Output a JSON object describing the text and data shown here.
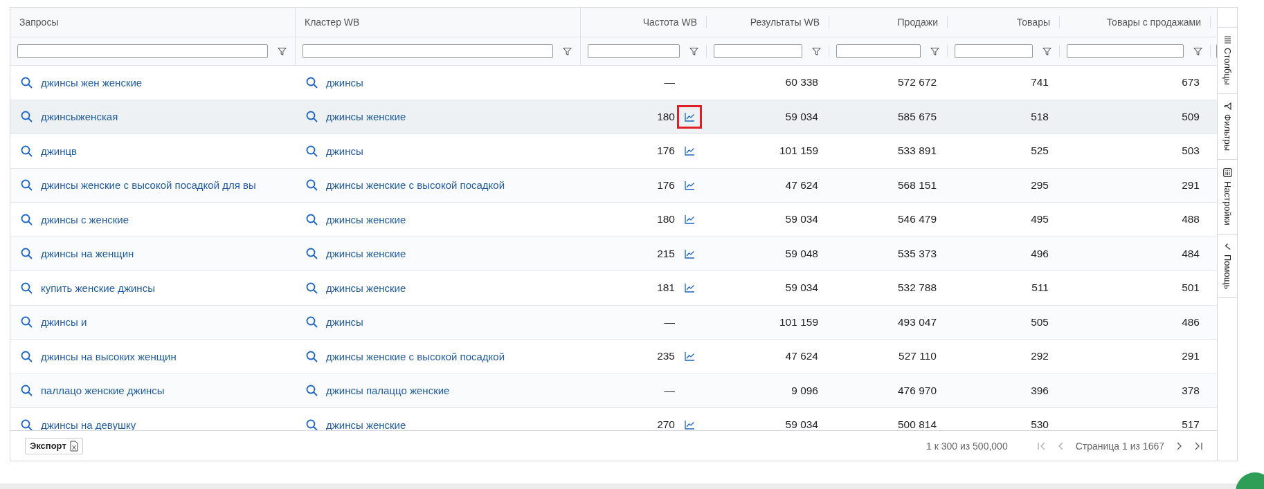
{
  "table": {
    "columns": [
      {
        "label": "Запросы"
      },
      {
        "label": "Кластер WB"
      },
      {
        "label": "Частота WB"
      },
      {
        "label": "Результаты WB"
      },
      {
        "label": "Продажи"
      },
      {
        "label": "Товары"
      },
      {
        "label": "Товары с продажами"
      }
    ],
    "rows": [
      {
        "query": "джинсы жен женские",
        "cluster": "джинсы",
        "frequency": "—",
        "chart": false,
        "results": "60 338",
        "sales": "572 672",
        "products": "741",
        "products_with_sales": "673",
        "selected": false
      },
      {
        "query": "джинсыженская",
        "cluster": "джинсы женские",
        "frequency": "180",
        "chart": true,
        "chart_highlighted": true,
        "results": "59 034",
        "sales": "585 675",
        "products": "518",
        "products_with_sales": "509",
        "selected": true
      },
      {
        "query": "джинцв",
        "cluster": "джинсы",
        "frequency": "176",
        "chart": true,
        "chart_highlighted": false,
        "results": "101 159",
        "sales": "533 891",
        "products": "525",
        "products_with_sales": "503",
        "selected": false
      },
      {
        "query": "джинсы женские с высокой посадкой для вы",
        "cluster": "джинсы женские с высокой посадкой",
        "frequency": "176",
        "chart": true,
        "chart_highlighted": false,
        "results": "47 624",
        "sales": "568 151",
        "products": "295",
        "products_with_sales": "291",
        "selected": false
      },
      {
        "query": "джинсы с женские",
        "cluster": "джинсы женские",
        "frequency": "180",
        "chart": true,
        "chart_highlighted": false,
        "results": "59 034",
        "sales": "546 479",
        "products": "495",
        "products_with_sales": "488",
        "selected": false
      },
      {
        "query": "джинсы на женщин",
        "cluster": "джинсы женские",
        "frequency": "215",
        "chart": true,
        "chart_highlighted": false,
        "results": "59 048",
        "sales": "535 373",
        "products": "496",
        "products_with_sales": "484",
        "selected": false
      },
      {
        "query": "купить женские джинсы",
        "cluster": "джинсы женские",
        "frequency": "181",
        "chart": true,
        "chart_highlighted": false,
        "results": "59 034",
        "sales": "532 788",
        "products": "511",
        "products_with_sales": "501",
        "selected": false
      },
      {
        "query": "джинсы и",
        "cluster": "джинсы",
        "frequency": "—",
        "chart": false,
        "results": "101 159",
        "sales": "493 047",
        "products": "505",
        "products_with_sales": "486",
        "selected": false
      },
      {
        "query": "джинсы на высоких женщин",
        "cluster": "джинсы женские с высокой посадкой",
        "frequency": "235",
        "chart": true,
        "chart_highlighted": false,
        "results": "47 624",
        "sales": "527 110",
        "products": "292",
        "products_with_sales": "291",
        "selected": false
      },
      {
        "query": "паллацо женские джинсы",
        "cluster": "джинсы палаццо женские",
        "frequency": "—",
        "chart": false,
        "results": "9 096",
        "sales": "476 970",
        "products": "396",
        "products_with_sales": "378",
        "selected": false
      },
      {
        "query": "джинсы на девушку",
        "cluster": "джинсы женские",
        "frequency": "270",
        "chart": true,
        "chart_highlighted": false,
        "results": "59 034",
        "sales": "500 814",
        "products": "530",
        "products_with_sales": "517",
        "selected": false
      }
    ]
  },
  "side_panel": {
    "tabs": [
      {
        "label": "Столбцы",
        "kind": "columns"
      },
      {
        "label": "Фильтры",
        "kind": "filters"
      },
      {
        "label": "Настройки",
        "kind": "settings"
      },
      {
        "label": "Помощь",
        "kind": "help"
      }
    ]
  },
  "footer": {
    "export_button": "Экспорт",
    "row_summary": "1 к 300 из 500,000",
    "page_label": "Страница 1 из 1667",
    "first_disabled": true,
    "prev_disabled": true,
    "next_disabled": false,
    "last_disabled": false
  }
}
